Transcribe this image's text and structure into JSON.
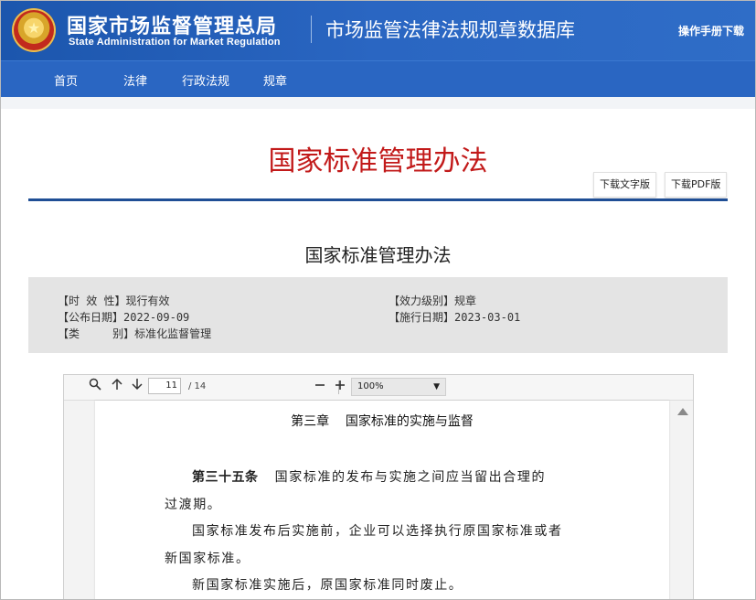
{
  "header": {
    "emblem_glyph": "★",
    "agency_cn": "国家市场监督管理总局",
    "agency_en": "State Administration for Market Regulation",
    "site_name": "市场监管法律法规规章数据库",
    "manual_link": "操作手册下载"
  },
  "nav": {
    "items": [
      "首页",
      "法律",
      "行政法规",
      "规章"
    ]
  },
  "document": {
    "main_title": "国家标准管理办法",
    "download_text": "下载文字版",
    "download_pdf": "下载PDF版",
    "title": "国家标准管理办法"
  },
  "meta": {
    "validity_label": "【时 效 性】",
    "validity": "现行有效",
    "level_label": "【效力级别】",
    "level": "规章",
    "publish_label": "【公布日期】",
    "publish_date": "2022-09-09",
    "effective_label": "【施行日期】",
    "effective_date": "2023-03-01",
    "category_label": "【类     别】",
    "category": "标准化监督管理"
  },
  "viewer": {
    "current_page": "11",
    "total_pages": "/ 14",
    "zoom": "100%",
    "icons": [
      "search-icon",
      "arrow-up-icon",
      "arrow-down-icon",
      "zoom-out-icon",
      "zoom-in-icon"
    ]
  },
  "pdf_content": {
    "chapter": "第三章    国家标准的实施与监督",
    "article_label": "第三十五条",
    "article_text": "国家标准的发布与实施之间应当留出合理的",
    "line2": "过渡期。",
    "line3": "国家标准发布后实施前，企业可以选择执行原国家标准或者",
    "line4": "新国家标准。",
    "line5": "新国家标准实施后，原国家标准同时废止。"
  },
  "colors": {
    "header_blue": "#2a66c2",
    "title_red": "#c21a1a",
    "rule_blue": "#1f4e95"
  }
}
